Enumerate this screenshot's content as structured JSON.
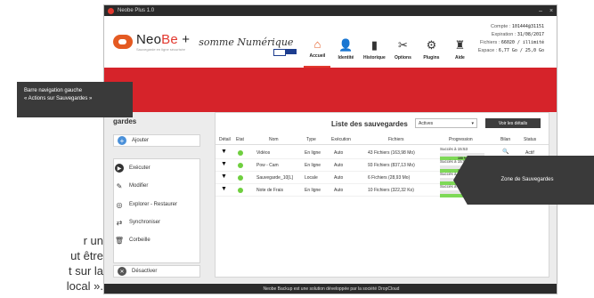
{
  "side_caption": {
    "lines": [
      "r un",
      "ut être",
      "t sur la",
      " local »."
    ]
  },
  "window": {
    "title": "Neobe Plus 1.0",
    "minimize": "–",
    "close": "×"
  },
  "brand": {
    "name_part1": "Neo",
    "name_part2": "Be",
    "plus": "+",
    "tagline": "Sauvegarde en ligne sécurisée",
    "partner": "somme Numérique"
  },
  "toolbar": [
    {
      "label": "Accueil",
      "icon": "home-icon",
      "glyph": "⌂"
    },
    {
      "label": "Identité",
      "icon": "user-icon",
      "glyph": "👤"
    },
    {
      "label": "Historique",
      "icon": "history-icon",
      "glyph": "▮"
    },
    {
      "label": "Options",
      "icon": "tools-icon",
      "glyph": "✂"
    },
    {
      "label": "Plugins",
      "icon": "plugins-icon",
      "glyph": "⚙"
    },
    {
      "label": "Aide",
      "icon": "help-icon",
      "glyph": "♜"
    }
  ],
  "account": {
    "compte_label": "Compte :",
    "compte_value": "101444@31151",
    "expiration_label": "Expiration :",
    "expiration_value": "31/08/2017",
    "fichiers_label": "Fichiers :",
    "fichiers_value": "66020 / illimité",
    "espace_label": "Espace :",
    "espace_value": "6,77 Go / 25,0 Go"
  },
  "sidebar": {
    "title": "gardes",
    "add": "Ajouter",
    "items": [
      "Exécuter",
      "Modifier",
      "Explorer - Restaurer",
      "Synchroniser",
      "Corbeille"
    ],
    "deactivate": "Désactiver"
  },
  "panel": {
    "title": "Liste des sauvegardes",
    "filter_value": "Actives",
    "details_button": "Voir les détails",
    "columns": [
      "Détail",
      "Etat",
      "Nom",
      "Type",
      "Exécution",
      "Fichiers",
      "Progression",
      "Bilan",
      "Status"
    ],
    "rows": [
      {
        "name": "Vidéos",
        "type": "En ligne",
        "exec": "Auto",
        "files": "43 Fichiers (163,98 Mo)",
        "progress_text": "Succès à 15:53",
        "progress": 100,
        "progress_label": "100 %",
        "bilan": "🔍",
        "status": "Actif"
      },
      {
        "name": "Pow - Cam",
        "type": "En ligne",
        "exec": "Auto",
        "files": "93 Fichiers (837,13 Mo)",
        "progress_text": "Succès à 15:53",
        "progress": 100,
        "progress_label": "100 %",
        "bilan": "",
        "status": ""
      },
      {
        "name": "Sauvegarde_10[L]",
        "type": "Locale",
        "exec": "Auto",
        "files": "6 Fichiers (28,93 Mo)",
        "progress_text": "Succès à 15:53",
        "progress": 100,
        "progress_label": "100 %",
        "bilan": "",
        "status": ""
      },
      {
        "name": "Note de Frais",
        "type": "En ligne",
        "exec": "Auto",
        "files": "10 Fichiers (322,32 Ko)",
        "progress_text": "Succès à 1",
        "progress": 100,
        "progress_label": "",
        "bilan": "",
        "status": ""
      }
    ]
  },
  "statusbar": "Neobe Backup est une solution développée par la société DropCloud",
  "callouts": {
    "left_line1": "Barre navigation gauche",
    "left_line2": "« Actions sur Sauvegardes »",
    "right": "Zone de Sauvegardes"
  }
}
